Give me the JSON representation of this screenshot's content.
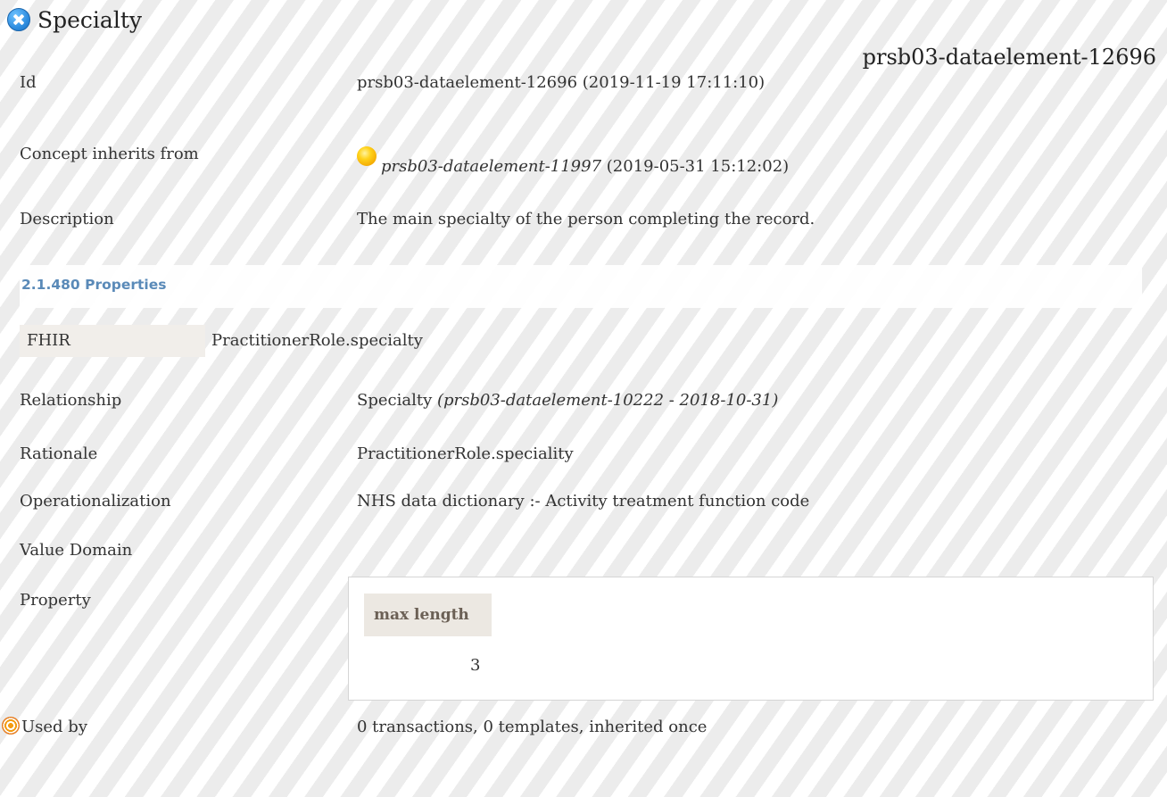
{
  "header": {
    "title": "Specialty",
    "element_id": "prsb03-dataelement-12696"
  },
  "fields": {
    "id_label": "Id",
    "id_value": "prsb03-dataelement-12696 (2019-11-19 17:11:10)",
    "inherits_label": "Concept inherits from",
    "inherits_ref": "prsb03-dataelement-11997",
    "inherits_date": "(2019-05-31 15:12:02)",
    "description_label": "Description",
    "description_value": "The main specialty of the person completing the record."
  },
  "properties_section": {
    "title": "2.1.480 Properties",
    "fhir_label": "FHIR",
    "fhir_value": "PractitionerRole.specialty",
    "relationship_label": "Relationship",
    "relationship_name": "Specialty",
    "relationship_ref": "(prsb03-dataelement-10222 - 2018-10-31)",
    "rationale_label": "Rationale",
    "rationale_value": "PractitionerRole.speciality",
    "operationalization_label": "Operationalization",
    "operationalization_value": "NHS data dictionary :- Activity treatment function code",
    "value_domain_label": "Value Domain",
    "property_label": "Property",
    "property_table": {
      "header": "max length",
      "value": "3"
    },
    "used_by_label": "Used by",
    "used_by_value": "0 transactions, 0 templates, inherited once"
  },
  "icons": {
    "title_icon": "close-icon",
    "inherits_icon": "yellow-ball-icon",
    "used_by_icon": "target-icon"
  }
}
